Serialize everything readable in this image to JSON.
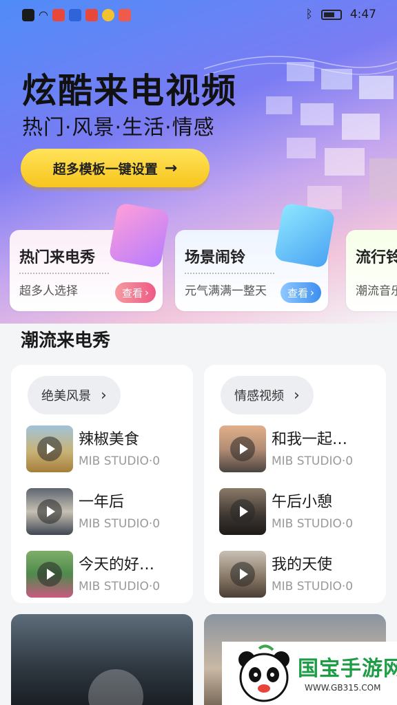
{
  "status_bar": {
    "time": "4:47"
  },
  "hero": {
    "title": "炫酷来电视频",
    "subtitle": "热门·风景·生活·情感",
    "cta_label": "超多模板一键设置",
    "cta_arrow": "→"
  },
  "categories": [
    {
      "title": "热门来电秀",
      "desc": "超多人选择",
      "button": "查看"
    },
    {
      "title": "场景闹铃",
      "desc": "元气满满一整天",
      "button": "查看"
    },
    {
      "title": "流行铃",
      "desc": "潮流音乐"
    }
  ],
  "section_title": "潮流来电秀",
  "panels": [
    {
      "chip": "绝美风景",
      "videos": [
        {
          "title": "辣椒美食",
          "meta": "MIB STUDIO·0"
        },
        {
          "title": "一年后",
          "meta": "MIB STUDIO·0"
        },
        {
          "title": "今天的好…",
          "meta": "MIB STUDIO·0"
        }
      ]
    },
    {
      "chip": "情感视频",
      "videos": [
        {
          "title": "和我一起…",
          "meta": "MIB STUDIO·0"
        },
        {
          "title": "午后小憩",
          "meta": "MIB STUDIO·0"
        },
        {
          "title": "我的天使",
          "meta": "MIB STUDIO·0"
        }
      ]
    }
  ],
  "watermark": {
    "name": "国宝手游网",
    "url": "WWW.GB315.COM"
  },
  "colors": {
    "cta_yellow": "#f9cf26",
    "pink_button": "#f06a8a",
    "blue_button": "#4aa3f2"
  }
}
